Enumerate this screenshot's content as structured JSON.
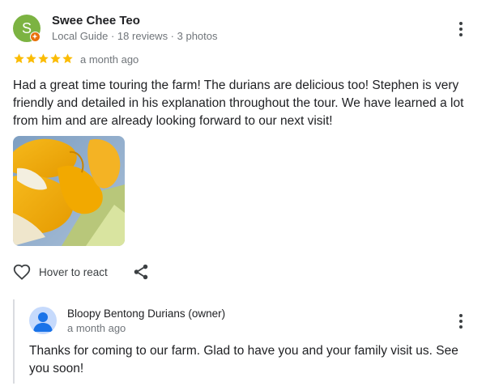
{
  "review": {
    "reviewer": {
      "avatar_initial": "S",
      "name": "Swee Chee Teo",
      "meta": "Local Guide · 18 reviews · 3 photos"
    },
    "rating": 5,
    "time": "a month ago",
    "text": "Had a great time touring the farm! The durians are delicious too! Stephen is very friendly and detailed in his explanation throughout the tour. We have learned a lot from him and are already looking forward to our next visit!",
    "actions": {
      "react_label": "Hover to react"
    },
    "icons": [
      "more-vert-icon",
      "star-icon",
      "heart-outline-icon",
      "share-icon",
      "local-guide-badge-icon",
      "person-icon"
    ]
  },
  "owner_reply": {
    "name": "Bloopy Bentong Durians (owner)",
    "time": "a month ago",
    "text": "Thanks for coming to our farm. Glad to have you and your family visit us. See you soon!"
  },
  "colors": {
    "star": "#fbbc04",
    "avatar": "#7cb342",
    "badge": "#e8710a",
    "owner_avatar": "#c6dafc",
    "owner_avatar_figure": "#1a73e8"
  }
}
